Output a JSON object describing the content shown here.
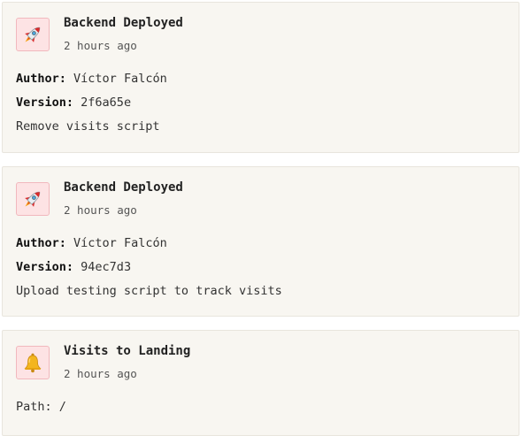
{
  "events": [
    {
      "icon": "rocket-icon",
      "title": "Backend Deployed",
      "time": "2 hours ago",
      "author_label": "Author:",
      "author": "Víctor Falcón",
      "version_label": "Version:",
      "version": "2f6a65e",
      "message": "Remove visits script"
    },
    {
      "icon": "rocket-icon",
      "title": "Backend Deployed",
      "time": "2 hours ago",
      "author_label": "Author:",
      "author": "Víctor Falcón",
      "version_label": "Version:",
      "version": "94ec7d3",
      "message": "Upload testing script to track visits"
    },
    {
      "icon": "bell-icon",
      "title": "Visits to Landing",
      "time": "2 hours ago",
      "path_label": "Path:",
      "path": "/"
    }
  ],
  "colors": {
    "card_background": "#f8f6f1",
    "card_border": "#e8e5dd",
    "icon_background": "#fde3e4",
    "icon_border": "#f1b8bd"
  }
}
